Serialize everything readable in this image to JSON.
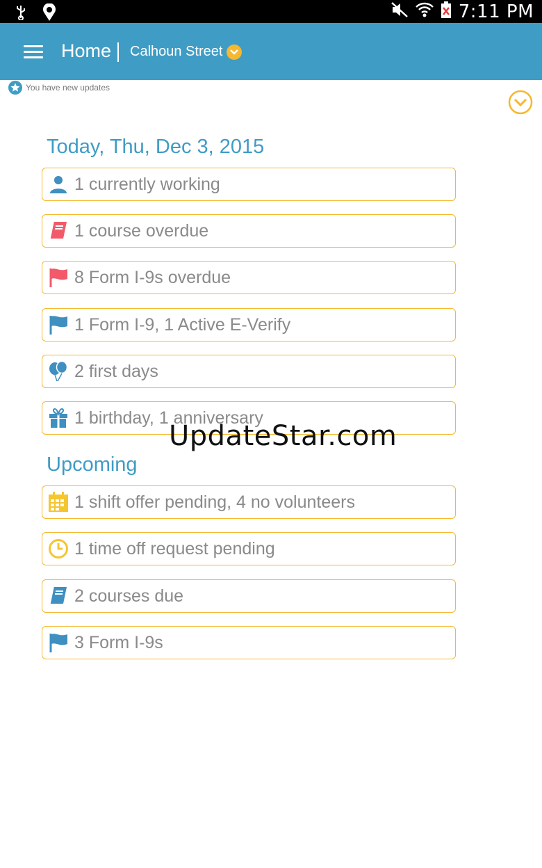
{
  "status_bar": {
    "time": "7:11 PM"
  },
  "app_bar": {
    "title": "Home",
    "location": "Calhoun Street"
  },
  "updates_notice": "You have new updates",
  "today": {
    "heading": "Today, Thu, Dec 3, 2015",
    "items": [
      {
        "icon": "person-icon",
        "text": "1 currently working"
      },
      {
        "icon": "book-icon",
        "text": "1 course overdue"
      },
      {
        "icon": "flag-icon",
        "text": "8 Form I-9s overdue"
      },
      {
        "icon": "flag-icon",
        "text": "1 Form I-9, 1 Active E-Verify"
      },
      {
        "icon": "balloons-icon",
        "text": "2 first days"
      },
      {
        "icon": "gift-icon",
        "text": "1 birthday, 1 anniversary"
      }
    ]
  },
  "upcoming": {
    "heading": "Upcoming",
    "items": [
      {
        "icon": "calendar-icon",
        "text": "1 shift offer pending, 4 no volunteers"
      },
      {
        "icon": "clock-icon",
        "text": "1 time off request pending"
      },
      {
        "icon": "book-icon",
        "text": "2 courses due"
      },
      {
        "icon": "flag-icon",
        "text": "3 Form I-9s"
      }
    ]
  },
  "watermark": "UpdateStar.com",
  "colors": {
    "app_bar": "#3f9cc5",
    "accent_border": "#f5b82e",
    "blue_icon": "#3f8fc0",
    "red_icon": "#f25a6a",
    "yellow_icon": "#f5c62e"
  }
}
